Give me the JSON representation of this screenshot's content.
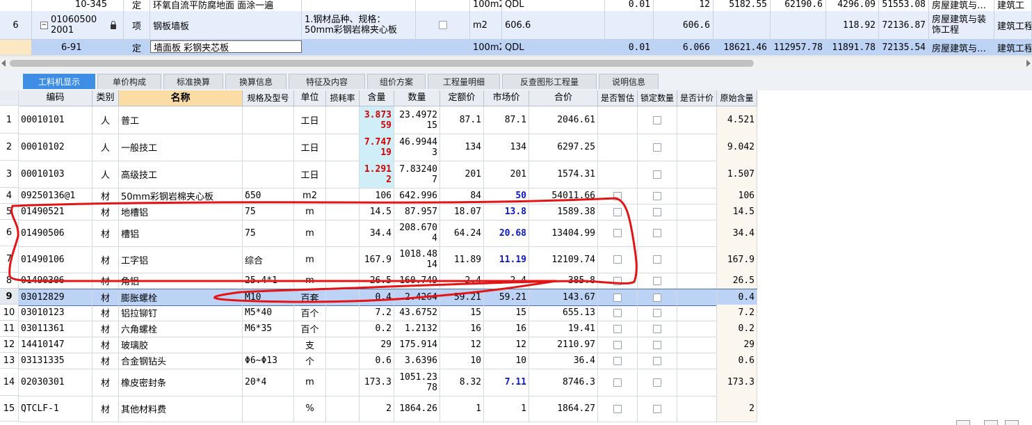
{
  "upper_rows": [
    {
      "tree": "10-345",
      "type": "定",
      "name": "环氧自流平防腐地面 面涂一遍",
      "spec": "",
      "unit": "100m2",
      "qty_expr": "QDL",
      "content": "0.01",
      "qty": "12",
      "price": "5182.55",
      "total": "62190.6",
      "c9": "4296.09",
      "c10": "51553.08",
      "major": "房屋建筑与…",
      "major2": "建筑工"
    },
    {
      "num": "6",
      "tree": "01060500 2001",
      "type": "项",
      "name": "钢板墙板",
      "spec": "1.钢材品种、规格：50mm彩钢岩棉夹心板",
      "unit": "m2",
      "qty_expr": "606.6",
      "content": "",
      "qty": "606.6",
      "price": "",
      "total": "",
      "c9": "118.92",
      "c10": "72136.87",
      "major": "房屋建筑与装饰工程",
      "major2": "建筑工程"
    },
    {
      "tree": "6-91",
      "type": "定",
      "name": "墙面板 彩钢夹芯板",
      "spec": "",
      "unit": "100m2",
      "qty_expr": "QDL",
      "content": "0.01",
      "qty": "6.066",
      "price": "18621.46",
      "total": "112957.78",
      "c9": "11891.78",
      "c10": "72135.54",
      "major": "房屋建筑与…",
      "major2": "建筑工程"
    }
  ],
  "tabs": [
    {
      "label": "工料机显示",
      "active": true
    },
    {
      "label": "单价构成"
    },
    {
      "label": "标准换算"
    },
    {
      "label": "换算信息"
    },
    {
      "label": "特征及内容"
    },
    {
      "label": "组价方案"
    },
    {
      "label": "工程量明细"
    },
    {
      "label": "反查图形工程量"
    },
    {
      "label": "说明信息"
    }
  ],
  "headers": {
    "code": "编码",
    "type": "类别",
    "name": "名称",
    "spec": "规格及型号",
    "unit": "单位",
    "loss": "损耗率",
    "content": "含量",
    "qty": "数量",
    "base_price": "定额价",
    "market_price": "市场价",
    "total": "合价",
    "estimate": "是否暂估",
    "lock_qty": "锁定数量",
    "bid": "是否计价",
    "orig": "原始含量"
  },
  "rows": [
    {
      "n": "1",
      "code": "00010101",
      "type": "人",
      "name": "普工",
      "spec": "",
      "unit": "工日",
      "content": "3.87359",
      "content_style": "red",
      "qty": "23.497215",
      "base": "87.1",
      "market": "87.1",
      "market_style": "",
      "total": "2046.61",
      "cb1": false,
      "cb2": true,
      "orig": "4.521"
    },
    {
      "n": "2",
      "code": "00010102",
      "type": "人",
      "name": "一般技工",
      "spec": "",
      "unit": "工日",
      "content": "7.74719",
      "content_style": "red",
      "qty": "46.99443",
      "base": "134",
      "market": "134",
      "market_style": "",
      "total": "6297.25",
      "cb1": false,
      "cb2": true,
      "orig": "9.042"
    },
    {
      "n": "3",
      "code": "00010103",
      "type": "人",
      "name": "高级技工",
      "spec": "",
      "unit": "工日",
      "content": "1.2912",
      "content_style": "red",
      "qty": "7.832407",
      "base": "201",
      "market": "201",
      "market_style": "",
      "total": "1574.31",
      "cb1": false,
      "cb2": true,
      "orig": "1.507"
    },
    {
      "n": "4",
      "code": "09250136@1",
      "type": "材",
      "name": "50mm彩钢岩棉夹心板",
      "spec": "δ50",
      "unit": "m2",
      "content": "106",
      "content_style": "",
      "qty": "642.996",
      "base": "84",
      "market": "50",
      "market_style": "blue",
      "total": "54011.66",
      "cb1": true,
      "cb2": true,
      "orig": "106"
    },
    {
      "n": "5",
      "code": "01490521",
      "type": "材",
      "name": "地槽铝",
      "spec": "75",
      "unit": "m",
      "content": "14.5",
      "content_style": "",
      "qty": "87.957",
      "base": "18.07",
      "market": "13.8",
      "market_style": "blue",
      "total": "1589.38",
      "cb1": true,
      "cb2": true,
      "orig": "14.5"
    },
    {
      "n": "6",
      "code": "01490506",
      "type": "材",
      "name": "槽铝",
      "spec": "75",
      "unit": "m",
      "content": "34.4",
      "content_style": "",
      "qty": "208.6704",
      "base": "64.24",
      "market": "20.68",
      "market_style": "blue",
      "total": "13404.99",
      "cb1": true,
      "cb2": true,
      "orig": "34.4"
    },
    {
      "n": "7",
      "code": "01490106",
      "type": "材",
      "name": "工字铝",
      "spec": "综合",
      "unit": "m",
      "content": "167.9",
      "content_style": "",
      "qty": "1018.4814",
      "base": "11.89",
      "market": "11.19",
      "market_style": "blue",
      "total": "12109.74",
      "cb1": true,
      "cb2": true,
      "orig": "167.9"
    },
    {
      "n": "8",
      "code": "01490306",
      "type": "材",
      "name": "角铝",
      "spec": "25.4*1",
      "unit": "m",
      "content": "26.5",
      "content_style": "",
      "qty": "160.749",
      "base": "2.4",
      "market": "2.4",
      "market_style": "",
      "total": "385.8",
      "cb1": true,
      "cb2": true,
      "orig": "26.5"
    },
    {
      "n": "9",
      "code": "03012829",
      "type": "材",
      "name": "膨胀螺栓",
      "spec": "M10",
      "unit": "百套",
      "content": "0.4",
      "content_style": "",
      "qty": "2.4264",
      "base": "59.21",
      "market": "59.21",
      "market_style": "",
      "total": "143.67",
      "cb1": true,
      "cb2": true,
      "orig": "0.4"
    },
    {
      "n": "10",
      "code": "03010123",
      "type": "材",
      "name": "铝拉铆钉",
      "spec": "M5*40",
      "unit": "百个",
      "content": "7.2",
      "content_style": "",
      "qty": "43.6752",
      "base": "15",
      "market": "15",
      "market_style": "",
      "total": "655.13",
      "cb1": true,
      "cb2": true,
      "orig": "7.2"
    },
    {
      "n": "11",
      "code": "03011361",
      "type": "材",
      "name": "六角螺栓",
      "spec": "M6*35",
      "unit": "百个",
      "content": "0.2",
      "content_style": "",
      "qty": "1.2132",
      "base": "16",
      "market": "16",
      "market_style": "",
      "total": "19.41",
      "cb1": true,
      "cb2": true,
      "orig": "0.2"
    },
    {
      "n": "12",
      "code": "14410147",
      "type": "材",
      "name": "玻璃胶",
      "spec": "",
      "unit": "支",
      "content": "29",
      "content_style": "",
      "qty": "175.914",
      "base": "12",
      "market": "12",
      "market_style": "",
      "total": "2110.97",
      "cb1": true,
      "cb2": true,
      "orig": "29"
    },
    {
      "n": "13",
      "code": "03131335",
      "type": "材",
      "name": "合金钢钻头",
      "spec": "Φ6~Φ13",
      "unit": "个",
      "content": "0.6",
      "content_style": "",
      "qty": "3.6396",
      "base": "10",
      "market": "10",
      "market_style": "",
      "total": "36.4",
      "cb1": true,
      "cb2": true,
      "orig": "0.6"
    },
    {
      "n": "14",
      "code": "02030301",
      "type": "材",
      "name": "橡皮密封条",
      "spec": "20*4",
      "unit": "m",
      "content": "173.3",
      "content_style": "",
      "qty": "1051.2378",
      "base": "8.32",
      "market": "7.11",
      "market_style": "blue",
      "total": "8746.3",
      "cb1": true,
      "cb2": true,
      "orig": "173.3"
    },
    {
      "n": "15",
      "code": "QTCLF-1",
      "type": "材",
      "name": "其他材料费",
      "spec": "",
      "unit": "%",
      "content": "2",
      "content_style": "",
      "qty": "1864.26",
      "base": "1",
      "market": "1",
      "market_style": "",
      "total": "1864.27",
      "cb1": true,
      "cb2": true,
      "orig": "2"
    }
  ],
  "selected_row": "9"
}
